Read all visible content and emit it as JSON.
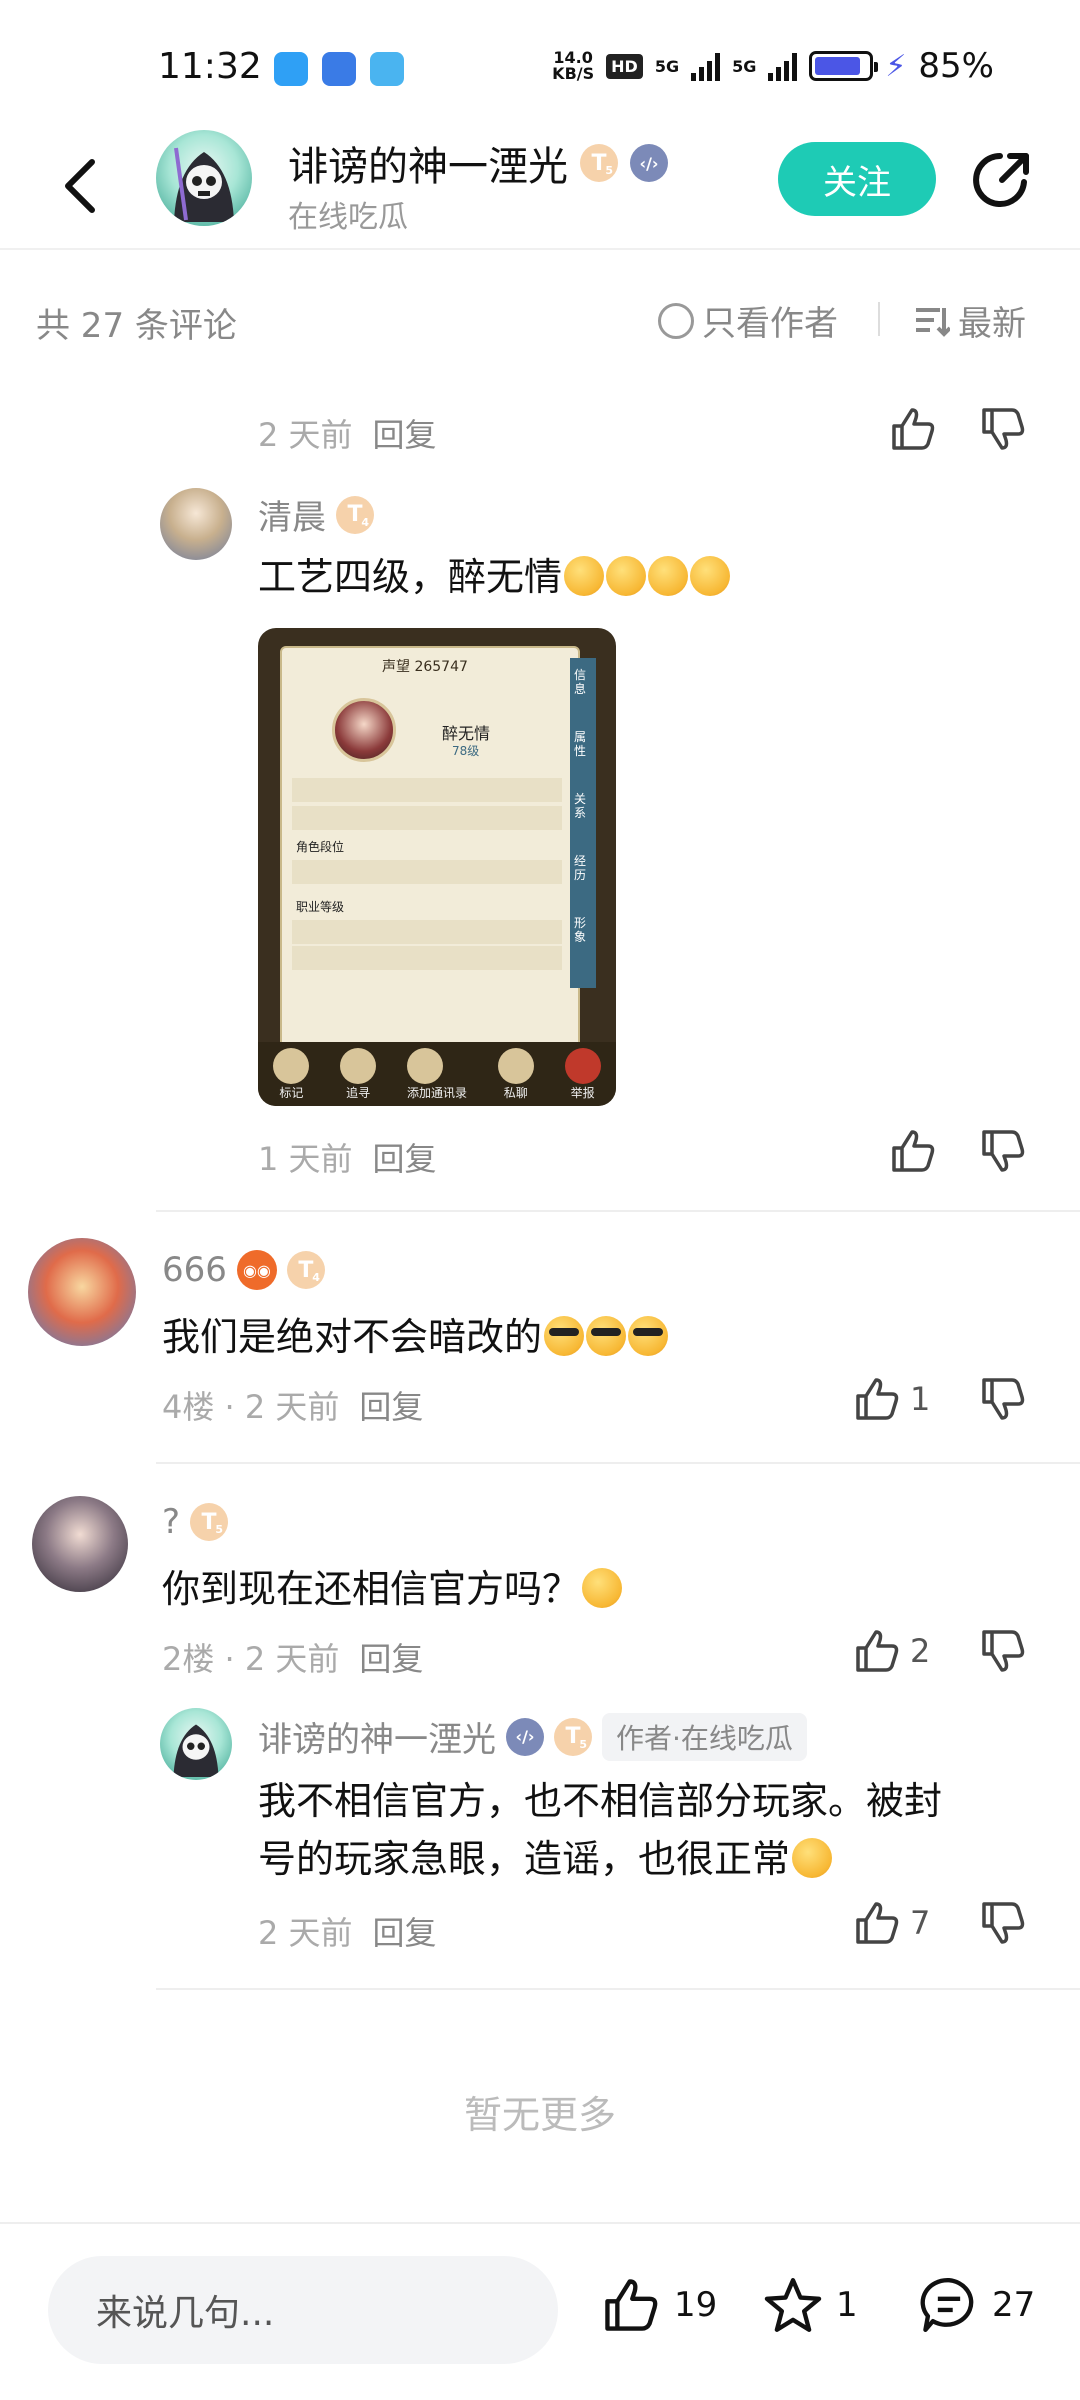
{
  "status": {
    "time": "11:32",
    "netspeed_value": "14.0",
    "netspeed_unit": "KB/S",
    "hd": "HD",
    "net1": "5G",
    "net2": "5G",
    "battery_pct": "85%",
    "battery_level": 0.85
  },
  "header": {
    "name": "诽谤的神一湮光",
    "subtitle": "在线吃瓜",
    "level_badge": "T",
    "level_num": "5",
    "follow_label": "关注"
  },
  "comment_bar": {
    "count_label": "共 27 条评论",
    "only_author_label": "只看作者",
    "sort_label": "最新"
  },
  "comments": {
    "c0": {
      "time": "2 天前",
      "reply": "回复"
    },
    "c1": {
      "user": "清晨",
      "level": "T",
      "level_num": "4",
      "text": "工艺四级，醉无情",
      "time": "1 天前",
      "reply": "回复",
      "image": {
        "reputation": "声望 265747",
        "char_name": "醉无情",
        "char_level": "78级",
        "tab1": "信息",
        "tab2": "属性",
        "tab3": "关系",
        "tab4": "经历",
        "tab5": "形象",
        "section1": "角色段位",
        "section2": "职业等级",
        "btn1": "标记",
        "btn2": "追寻",
        "btn3": "添加通讯录",
        "btn4": "私聊",
        "btn5": "举报"
      }
    },
    "c2": {
      "user": "666",
      "level": "T",
      "level_num": "4",
      "text": "我们是绝对不会暗改的",
      "floor": "4楼 · 2 天前",
      "reply": "回复",
      "likes": "1"
    },
    "c3": {
      "user": "?",
      "level": "T",
      "level_num": "5",
      "text": "你到现在还相信官方吗？",
      "floor": "2楼 · 2 天前",
      "reply": "回复",
      "likes": "2"
    },
    "c4": {
      "user": "诽谤的神一湮光",
      "level": "T",
      "level_num": "5",
      "author_tag": "作者·在线吃瓜",
      "text_line1": "我不相信官方，也不相信部分玩家。被封",
      "text_line2": "号的玩家急眼，造谣，也很正常",
      "time": "2 天前",
      "reply": "回复",
      "likes": "7"
    }
  },
  "no_more": "暂无更多",
  "bottom_bar": {
    "input_placeholder": "来说几句...",
    "likes": "19",
    "stars": "1",
    "comments": "27"
  },
  "colors": {
    "accent": "#1ecbb5",
    "battery": "#4b56e6"
  }
}
